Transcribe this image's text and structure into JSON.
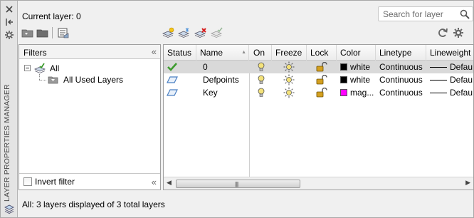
{
  "panel": {
    "vertical_title": "LAYER PROPERTIES MANAGER",
    "current_layer_label": "Current layer: 0"
  },
  "search": {
    "placeholder": "Search for layer",
    "value": ""
  },
  "toolbar": {
    "left_icons": [
      "new-filter-icon",
      "new-group-filter-icon",
      "layer-states-icon"
    ],
    "mid_icons": [
      "new-layer-icon",
      "new-layer-vp-frozen-icon",
      "delete-layer-icon",
      "set-current-icon"
    ],
    "right_icons": [
      "refresh-icon",
      "settings-icon"
    ]
  },
  "filters": {
    "header": "Filters",
    "tree": [
      {
        "label": "All",
        "expanded": true
      },
      {
        "label": "All Used Layers"
      }
    ],
    "invert_filter_label": "Invert filter",
    "invert_filter_checked": false
  },
  "grid": {
    "columns": [
      "Status",
      "Name",
      "On",
      "Freeze",
      "Lock",
      "Color",
      "Linetype",
      "Lineweight"
    ],
    "sorted_column": "Name",
    "rows": [
      {
        "status": "current",
        "name": "0",
        "on": true,
        "freeze": false,
        "lock": false,
        "color": "white",
        "color_hex": "#000000",
        "linetype": "Continuous",
        "lineweight": "Defau",
        "selected": true
      },
      {
        "status": "layer",
        "name": "Defpoints",
        "on": true,
        "freeze": false,
        "lock": false,
        "color": "white",
        "color_hex": "#000000",
        "linetype": "Continuous",
        "lineweight": "Defau",
        "selected": false
      },
      {
        "status": "layer",
        "name": "Key",
        "on": true,
        "freeze": false,
        "lock": false,
        "color": "mag...",
        "color_hex": "#ff00ff",
        "linetype": "Continuous",
        "lineweight": "Defau",
        "selected": false
      }
    ]
  },
  "status_bar": {
    "text": "All: 3 layers displayed of 3 total layers"
  },
  "colors": {
    "panel_bg": "#f0f0f0",
    "selected_row": "#d9d9d9",
    "status_blue": "#4a7fc2",
    "status_green": "#3c9b2d",
    "bulb_yellow": "#f4e27a",
    "lock_gold": "#d4a020"
  }
}
